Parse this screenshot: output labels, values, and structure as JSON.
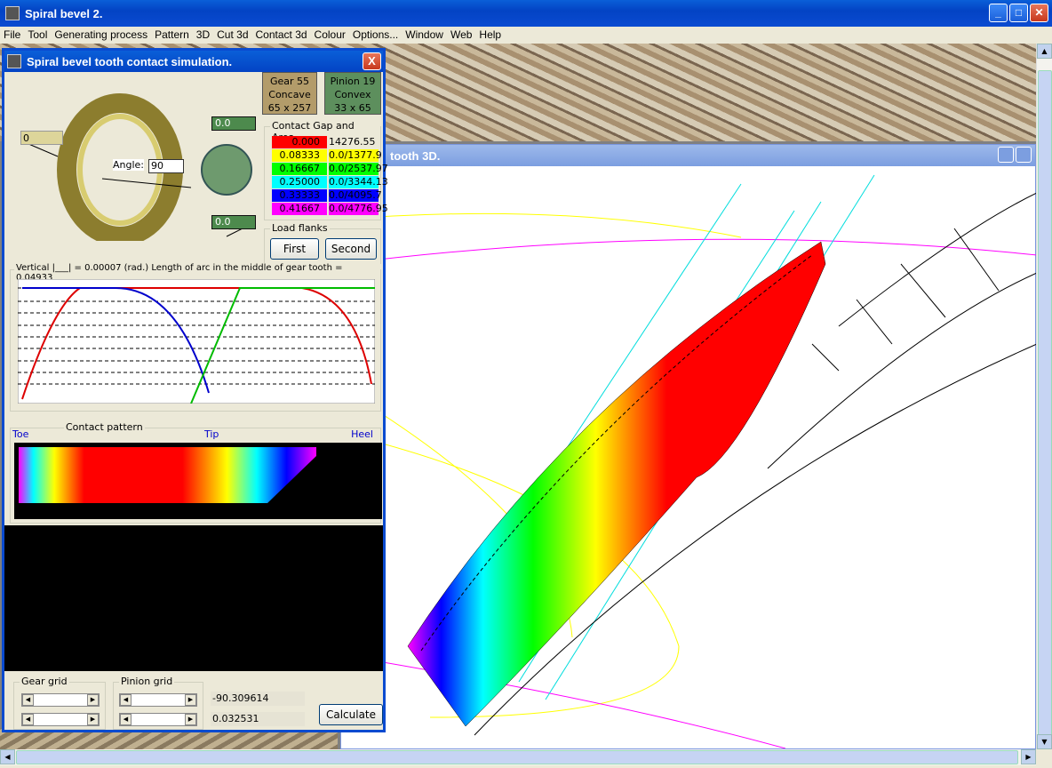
{
  "window": {
    "title": "Spiral bevel 2.",
    "min": "_",
    "max": "□",
    "close": "✕"
  },
  "menu": [
    "File",
    "Tool",
    "Generating process",
    "Pattern",
    "3D",
    "Cut 3d",
    "Contact 3d",
    "Colour",
    "Options...",
    "Window",
    "Web",
    "Help"
  ],
  "child3d": {
    "title": "tooth 3D."
  },
  "dialog": {
    "title": "Spiral bevel tooth contact simulation.",
    "close": "X",
    "gear_box": {
      "l1": "Gear 55",
      "l2": "Concave",
      "l3": "65 x 257"
    },
    "pinion_box": {
      "l1": "Pinion 19",
      "l2": "Convex",
      "l3": "33 x 65"
    },
    "angle_label": "Angle:",
    "angle_value": "90",
    "left_field": "0",
    "top_field": "0.0",
    "bottom_field": "0.0",
    "contact_group": "Contact  Gap and Area",
    "contact_rows": [
      {
        "gap": "0.000",
        "area": "14276.55",
        "color": "#ff0000",
        "acolor": "#ece9d8"
      },
      {
        "gap": "0.08333",
        "area": "0.0/1377.9",
        "color": "#ffff00",
        "acolor": "#ffff00"
      },
      {
        "gap": "0.16667",
        "area": "0.0/2537.97",
        "color": "#00ff00",
        "acolor": "#00ff00"
      },
      {
        "gap": "0.25000",
        "area": "0.0/3344.13",
        "color": "#00ffff",
        "acolor": "#00ffff"
      },
      {
        "gap": "0.33333",
        "area": "0.0/4095.7",
        "color": "#0000ff",
        "acolor": "#0000ff"
      },
      {
        "gap": "0.41667",
        "area": "0.0/4776.95",
        "color": "#ff00ff",
        "acolor": "#ff00ff"
      }
    ],
    "load_group": "Load flanks",
    "first": "First",
    "second": "Second",
    "chart_caption": "Vertical |___| =  0.00007 (rad.) Length of arc in the middle of gear tooth =  0.04933",
    "contact_pattern": "Contact pattern",
    "toe": "Toe",
    "tip": "Tip",
    "heel": "Heel",
    "gear_grid": "Gear grid",
    "pinion_grid": "Pinion grid",
    "value1": "-90.309614",
    "value2": "0.032531",
    "calculate": "Calculate"
  }
}
